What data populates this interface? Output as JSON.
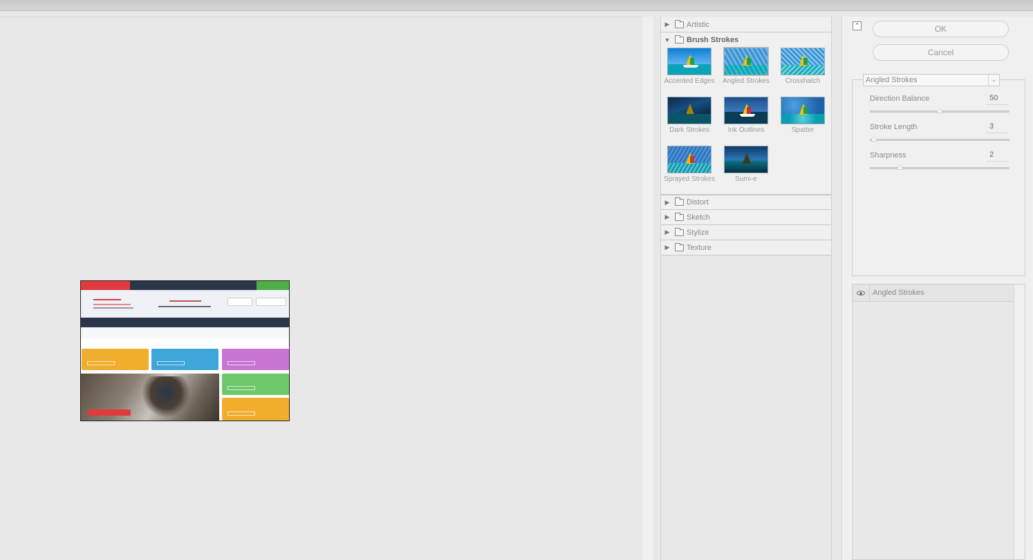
{
  "window": {
    "title": ""
  },
  "filter_list": {
    "folders_top": [
      {
        "label": "Artistic",
        "open": false
      }
    ],
    "open_folder": {
      "label": "Brush Strokes",
      "filters": [
        {
          "label": "Accented Edges"
        },
        {
          "label": "Angled Strokes"
        },
        {
          "label": "Crosshatch"
        },
        {
          "label": "Dark Strokes"
        },
        {
          "label": "Ink Outlines"
        },
        {
          "label": "Spatter"
        },
        {
          "label": "Sprayed Strokes"
        },
        {
          "label": "Sumi-e"
        }
      ]
    },
    "folders_bottom": [
      {
        "label": "Distort",
        "open": false
      },
      {
        "label": "Sketch",
        "open": false
      },
      {
        "label": "Stylize",
        "open": false
      },
      {
        "label": "Texture",
        "open": false
      }
    ]
  },
  "options": {
    "ok_label": "OK",
    "cancel_label": "Cancel",
    "selected_filter": "Angled Strokes",
    "params": [
      {
        "label": "Direction Balance",
        "value": "50",
        "fraction": 0.5
      },
      {
        "label": "Stroke Length",
        "value": "3",
        "fraction": 0.0
      },
      {
        "label": "Sharpness",
        "value": "2",
        "fraction": 0.2
      }
    ],
    "layers": [
      {
        "label": "Angled Strokes",
        "visible": true
      }
    ]
  }
}
